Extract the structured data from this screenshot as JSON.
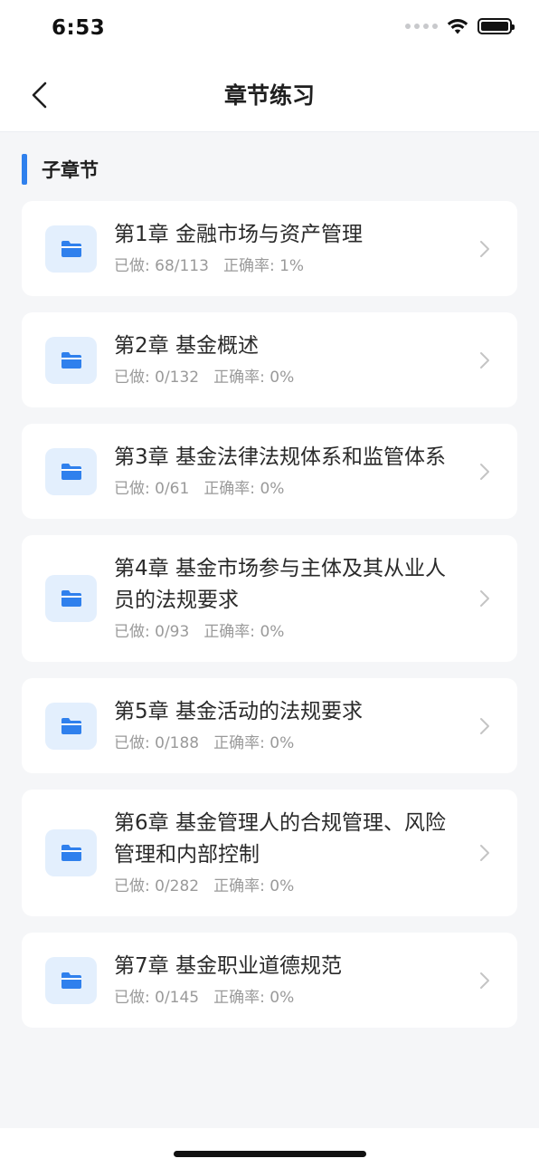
{
  "status_bar": {
    "time": "6:53"
  },
  "nav": {
    "title": "章节练习"
  },
  "section": {
    "title": "子章节"
  },
  "colors": {
    "accent": "#2f80ed",
    "icon_bg": "#e3effd"
  },
  "chapters": [
    {
      "title": "第1章 金融市场与资产管理",
      "done": "已做: 68/113",
      "accuracy": "正确率: 1%"
    },
    {
      "title": "第2章 基金概述",
      "done": "已做: 0/132",
      "accuracy": "正确率: 0%"
    },
    {
      "title": "第3章 基金法律法规体系和监管体系",
      "done": "已做: 0/61",
      "accuracy": "正确率: 0%"
    },
    {
      "title": "第4章 基金市场参与主体及其从业人员的法规要求",
      "done": "已做: 0/93",
      "accuracy": "正确率: 0%"
    },
    {
      "title": "第5章 基金活动的法规要求",
      "done": "已做: 0/188",
      "accuracy": "正确率: 0%"
    },
    {
      "title": "第6章 基金管理人的合规管理、风险管理和内部控制",
      "done": "已做: 0/282",
      "accuracy": "正确率: 0%"
    },
    {
      "title": "第7章 基金职业道德规范",
      "done": "已做: 0/145",
      "accuracy": "正确率: 0%"
    }
  ],
  "icons": {
    "back": "chevron-left-icon",
    "folder": "folder-icon",
    "item_arrow": "chevron-right-icon",
    "wifi": "wifi-icon",
    "battery": "battery-icon"
  }
}
